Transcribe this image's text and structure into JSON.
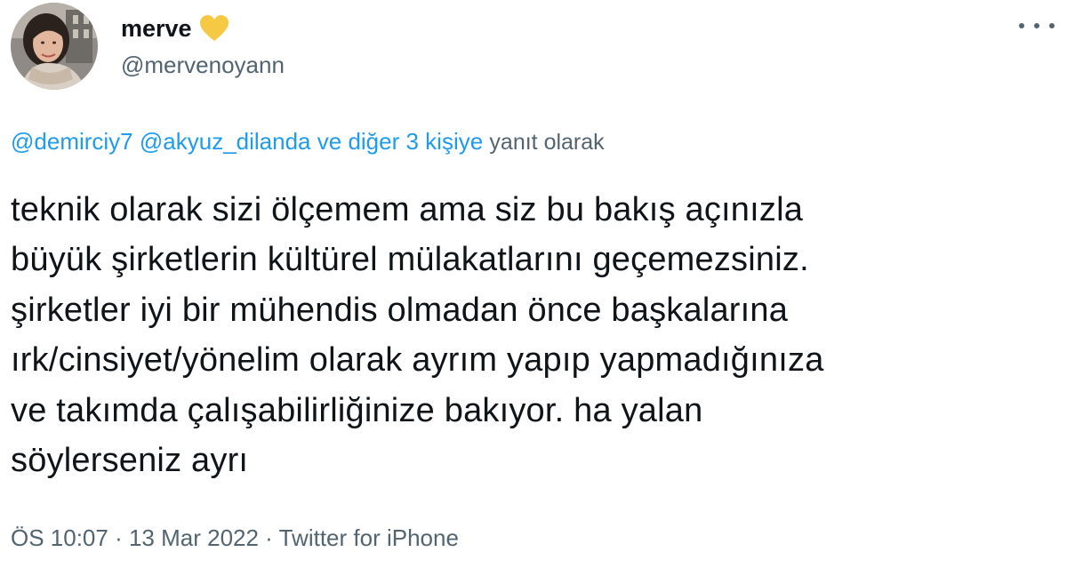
{
  "author": {
    "display_name": "merve",
    "handle": "@mervenoyann",
    "badge_icon": "yellow-heart-icon",
    "badge_color": "#f6c945"
  },
  "reply_context": {
    "mention_1": "@demirciy7",
    "mention_2": "@akyuz_dilanda",
    "others_link": "ve diğer 3 kişiye",
    "suffix": "yanıt olarak"
  },
  "tweet": {
    "text": "teknik olarak sizi ölçemem ama siz bu bakış açınızla\nbüyük şirketlerin kültürel mülakatlarını geçemezsiniz.\nşirketler iyi bir mühendis olmadan önce başkalarına\nırk/cinsiyet/yönelim olarak ayrım yapıp yapmadığınıza\nve takımda çalışabilirliğinize bakıyor. ha yalan\nsöylerseniz ayrı"
  },
  "meta": {
    "time": "ÖS 10:07",
    "separator_1": " · ",
    "date": "13 Mar 2022",
    "separator_2": " · ",
    "source": "Twitter for iPhone"
  },
  "colors": {
    "link": "#1d9bf0",
    "muted": "#536471",
    "text": "#0f1419"
  }
}
